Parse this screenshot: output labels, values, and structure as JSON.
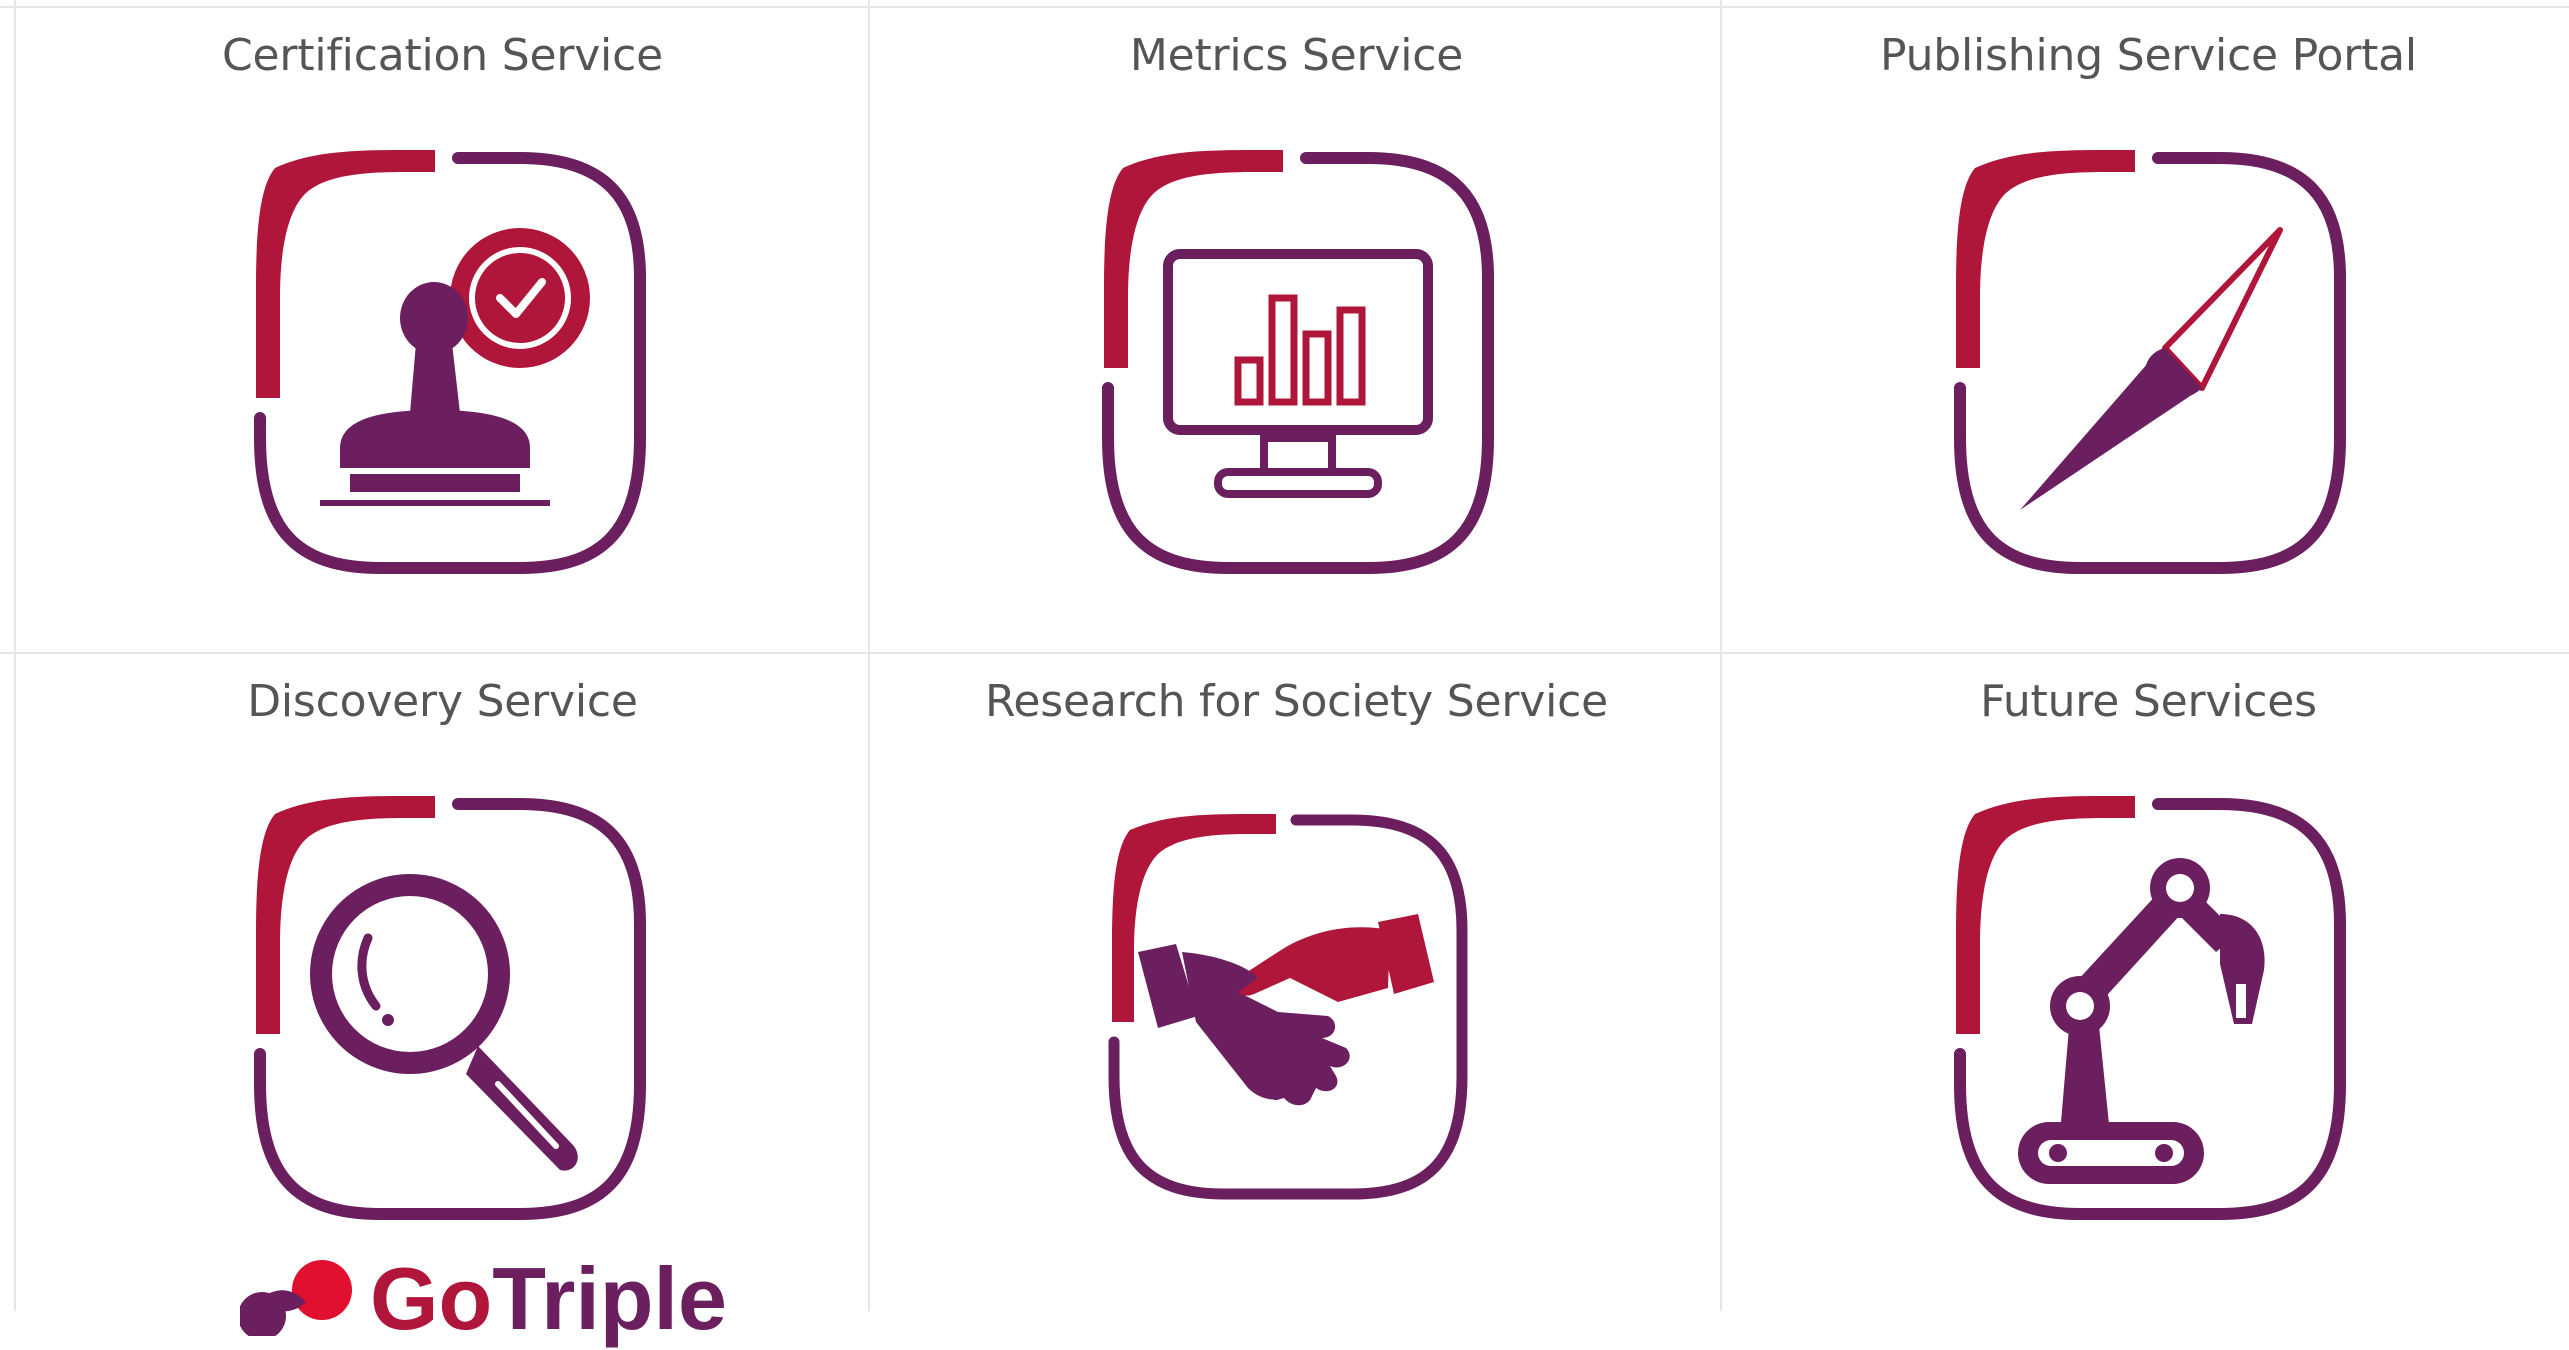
{
  "services": [
    {
      "id": "certification",
      "title": "Certification Service",
      "icon": "certification-stamp-icon"
    },
    {
      "id": "metrics",
      "title": "Metrics Service",
      "icon": "monitor-bar-chart-icon"
    },
    {
      "id": "publishing",
      "title": "Publishing Service Portal",
      "icon": "compass-needle-icon"
    },
    {
      "id": "discovery",
      "title": "Discovery Service",
      "icon": "magnifying-glass-icon"
    },
    {
      "id": "research-society",
      "title": "Research for Society Service",
      "icon": "handshake-icon"
    },
    {
      "id": "future",
      "title": "Future Services",
      "icon": "robot-arm-icon"
    }
  ],
  "logo": {
    "text_part1": "Go",
    "text_part2": "Triple"
  },
  "colors": {
    "purple": "#6b1f5f",
    "red": "#b0163a",
    "title": "#555555",
    "grid": "#e6e6e6"
  }
}
